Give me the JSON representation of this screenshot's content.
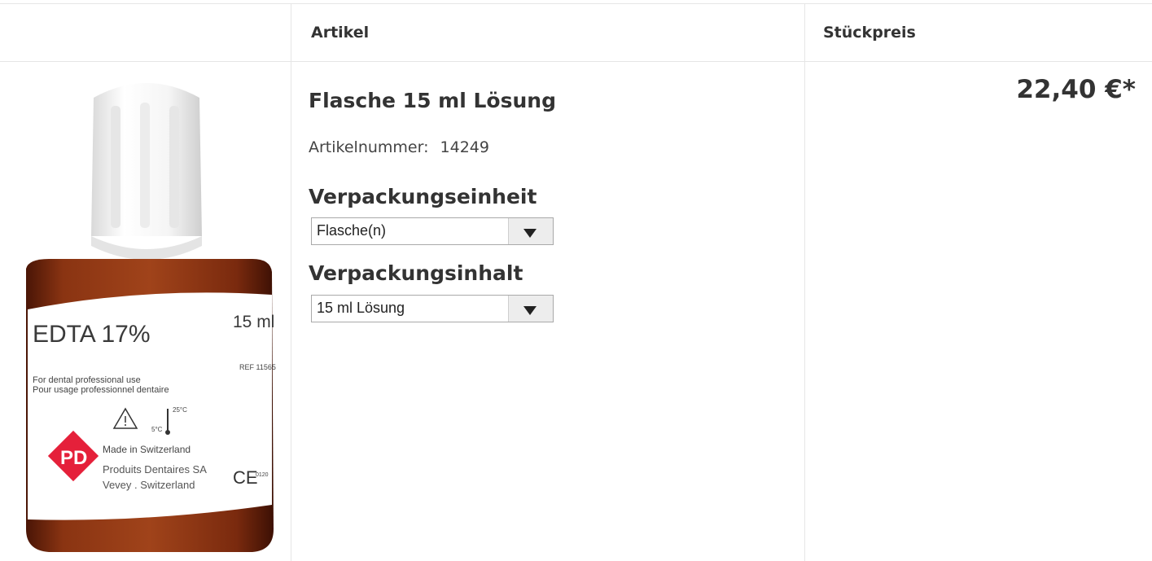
{
  "header": {
    "col_article": "Artikel",
    "col_unit_price": "Stückpreis"
  },
  "product": {
    "title": "Flasche 15 ml Lösung",
    "article_number_label": "Artikelnummer:",
    "article_number": "14249",
    "price": "22,40 €*",
    "image": {
      "label_title": "EDTA 17%",
      "label_volume": "15 ml",
      "label_ref": "REF 11565",
      "label_line1": "For dental professional use",
      "label_line2": "Pour usage professionnel dentaire",
      "temp_low": "5°C",
      "temp_high": "25°C",
      "made_in": "Made in Switzerland",
      "maker": "Produits Dentaires SA",
      "maker_city": "Vevey . Switzerland",
      "logo": "PD",
      "ce_mark": "CE",
      "ce_number": "0120",
      "bottle_color": "#7a2a0e",
      "cap_color": "#f2f2f2",
      "logo_color": "#e5203a"
    }
  },
  "options": {
    "packaging_unit_title": "Verpackungseinheit",
    "packaging_unit_value": "Flasche(n)",
    "packaging_content_title": "Verpackungsinhalt",
    "packaging_content_value": "15 ml Lösung",
    "dropdown_icon": "triangle-down"
  }
}
